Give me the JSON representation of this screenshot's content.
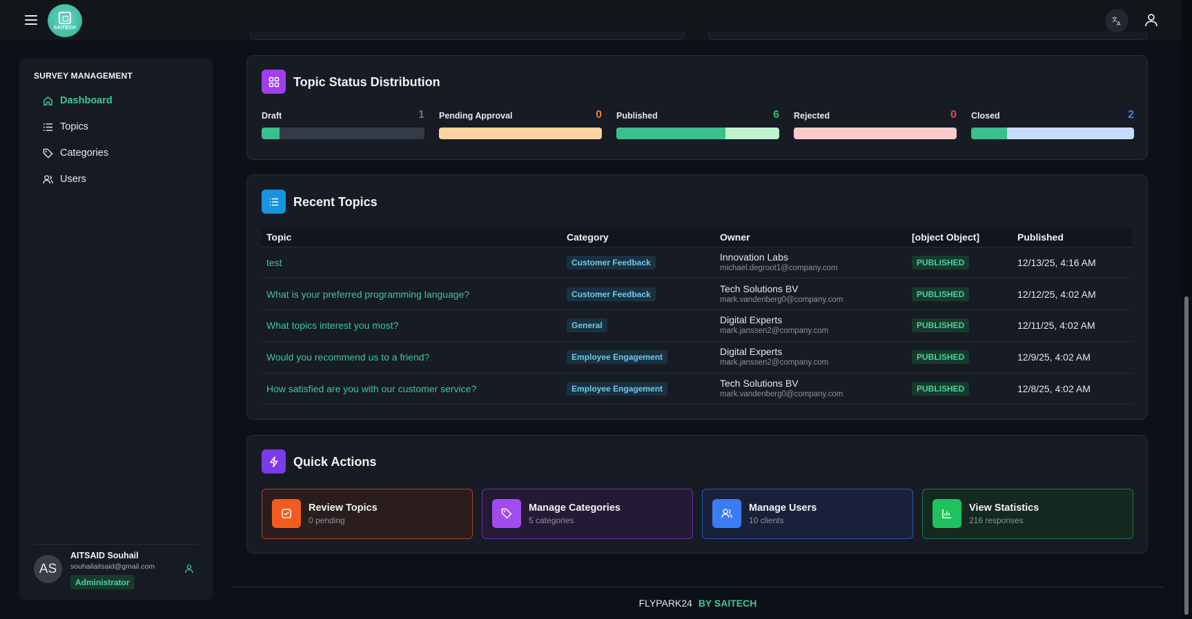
{
  "header": {
    "logo_text": "SAITECH",
    "menu_icon": "hamburger-icon",
    "translate_icon": "translate-icon",
    "user_icon": "user-icon"
  },
  "sidebar": {
    "heading": "SURVEY MANAGEMENT",
    "items": [
      {
        "label": "Dashboard",
        "icon": "home-icon",
        "active": true
      },
      {
        "label": "Topics",
        "icon": "list-icon",
        "active": false
      },
      {
        "label": "Categories",
        "icon": "tag-icon",
        "active": false
      },
      {
        "label": "Users",
        "icon": "users-icon",
        "active": false
      }
    ],
    "profile": {
      "initials": "AS",
      "name": "AITSAID Souhail",
      "email": "souhailaitsaid@gmail.com",
      "role": "Administrator"
    }
  },
  "status_distribution": {
    "title": "Topic Status Distribution",
    "items": [
      {
        "label": "Draft",
        "count": "1",
        "count_color": "#6b7480",
        "fill_fraction": 0.11,
        "track_color": "#353b46"
      },
      {
        "label": "Pending Approval",
        "count": "0",
        "count_color": "#f27d2a",
        "fill_fraction": 0,
        "track_color": "#fdd3a1"
      },
      {
        "label": "Published",
        "count": "6",
        "count_color": "#27c46f",
        "fill_fraction": 0.67,
        "track_color": "#bff3cf"
      },
      {
        "label": "Rejected",
        "count": "0",
        "count_color": "#f04545",
        "fill_fraction": 0,
        "track_color": "#fcc9cb"
      },
      {
        "label": "Closed",
        "count": "2",
        "count_color": "#3d86f5",
        "fill_fraction": 0.22,
        "track_color": "#c6dafc"
      }
    ]
  },
  "recent_topics": {
    "title": "Recent Topics",
    "columns": [
      "Topic",
      "Category",
      "Owner",
      "[object Object]",
      "Published"
    ],
    "rows": [
      {
        "topic": "test",
        "category": "Customer Feedback",
        "owner": "Innovation Labs",
        "email": "michael.degroot1@company.com",
        "status": "PUBLISHED",
        "published": "12/13/25, 4:16 AM"
      },
      {
        "topic": "What is your preferred programming language?",
        "category": "Customer Feedback",
        "owner": "Tech Solutions BV",
        "email": "mark.vandenberg0@company.com",
        "status": "PUBLISHED",
        "published": "12/12/25, 4:02 AM"
      },
      {
        "topic": "What topics interest you most?",
        "category": "General",
        "owner": "Digital Experts",
        "email": "mark.janssen2@company.com",
        "status": "PUBLISHED",
        "published": "12/11/25, 4:02 AM"
      },
      {
        "topic": "Would you recommend us to a friend?",
        "category": "Employee Engagement",
        "owner": "Digital Experts",
        "email": "mark.janssen2@company.com",
        "status": "PUBLISHED",
        "published": "12/9/25, 4:02 AM"
      },
      {
        "topic": "How satisfied are you with our customer service?",
        "category": "Employee Engagement",
        "owner": "Tech Solutions BV",
        "email": "mark.vandenberg0@company.com",
        "status": "PUBLISHED",
        "published": "12/8/25, 4:02 AM"
      }
    ]
  },
  "quick_actions": {
    "title": "Quick Actions",
    "items": [
      {
        "title": "Review Topics",
        "sub": "0 pending",
        "icon": "checkbox-icon",
        "color": "#f25c1f",
        "bg": "#2b1d1d",
        "border": "#b5401d"
      },
      {
        "title": "Manage Categories",
        "sub": "5 categories",
        "icon": "tag-icon",
        "color": "#a24bf0",
        "bg": "#241a35",
        "border": "#6c2fb0"
      },
      {
        "title": "Manage Users",
        "sub": "10 clients",
        "icon": "users-icon",
        "color": "#3b7cf3",
        "bg": "#19213a",
        "border": "#2b55b8"
      },
      {
        "title": "View Statistics",
        "sub": "216 responses",
        "icon": "bar-chart-icon",
        "color": "#20c25f",
        "bg": "#14291f",
        "border": "#1c7a47"
      }
    ]
  },
  "footer": {
    "brand": "FLYPARK24",
    "by": "BY SAITECH"
  }
}
